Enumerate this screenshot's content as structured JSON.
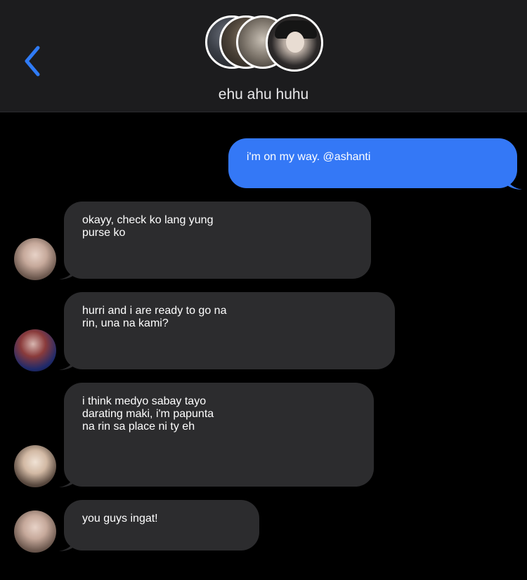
{
  "header": {
    "back_icon": "chevron-left-icon",
    "group_name": "ehu ahu huhu",
    "accent": "#2f7bf6"
  },
  "messages": [
    {
      "from": "me",
      "lines": [
        "i'm on my way. @ashanti"
      ]
    },
    {
      "from": "other",
      "avatar": "p1",
      "lines": [
        "okayy, check ko lang yung",
        "purse ko"
      ]
    },
    {
      "from": "other",
      "avatar": "p2",
      "lines": [
        "hurri and i are ready to go na",
        "rin, una na kami?"
      ]
    },
    {
      "from": "other",
      "avatar": "p3",
      "lines": [
        "i think medyo sabay tayo",
        "darating maki, i'm papunta",
        "na rin sa place ni ty eh"
      ]
    },
    {
      "from": "other",
      "avatar": "p1",
      "lines": [
        "you guys ingat!"
      ]
    }
  ],
  "colors": {
    "sent_bubble": "#3478f6",
    "received_bubble": "#2c2c2e",
    "background": "#000000",
    "header": "#1c1c1e"
  }
}
